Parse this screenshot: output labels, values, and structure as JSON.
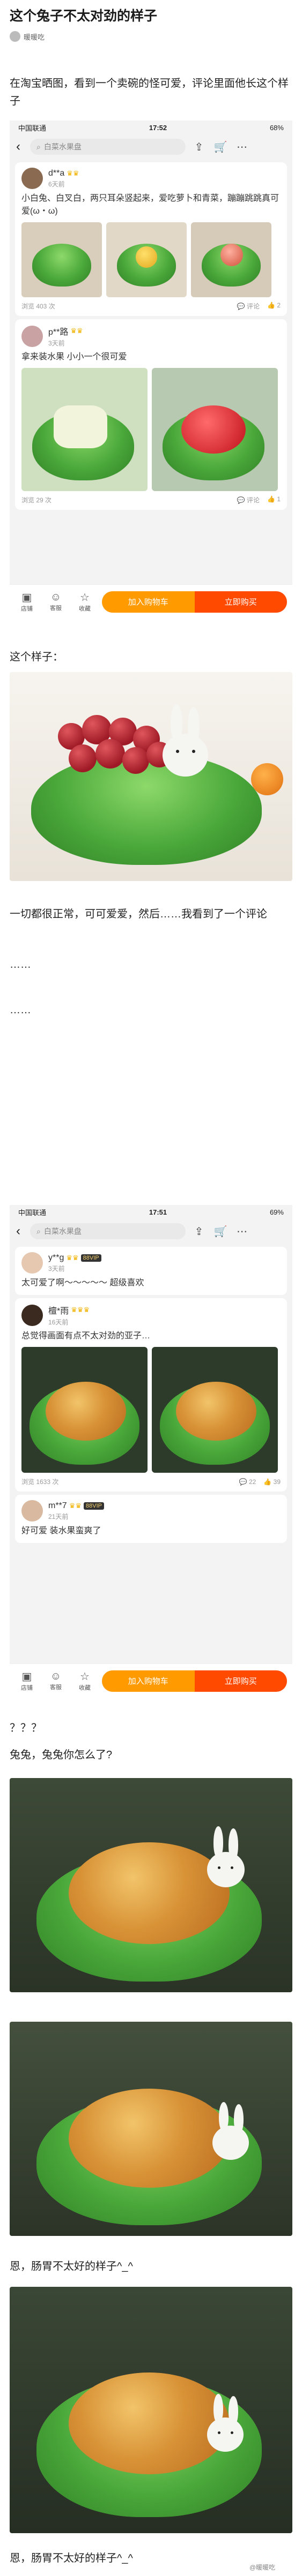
{
  "article": {
    "title": "这个兔子不太对劲的样子",
    "author": "暖暖吃",
    "intro": "在淘宝晒图，看到一个卖碗的怪可爱，评论里面他长这个样子",
    "para1": "这个样子：",
    "para2": "一切都很正常，可可爱爱，然后……我看到了一个评论",
    "ellipsis1": "……",
    "ellipsis2": "……",
    "q": "？？？",
    "q2": "兔兔，兔兔你怎么了?",
    "caption1": "恩，肠胃不太好的样子^_^",
    "caption2": "恩，肠胃不太好的样子^_^",
    "watermark": "@暖暖吃"
  },
  "phone1": {
    "carrier": "中国联通",
    "time": "17:52",
    "battery": "68%",
    "search_placeholder": "白菜水果盘",
    "comments": [
      {
        "user": "d**a",
        "date": "6天前",
        "text": "小白兔、白叉白，两只耳朵竖起来，爱吃萝卜和青菜，蹦蹦跳跳真可爱(ω・ω)",
        "views": "浏览 403 次",
        "r1": "评论",
        "r2": "2"
      },
      {
        "user": "p**路",
        "date": "3天前",
        "text": "拿来装水果 小小一个很可爱",
        "views": "浏览 29 次",
        "r1": "评论",
        "r2": "1"
      }
    ],
    "bar": {
      "shop": "店铺",
      "service": "客服",
      "fav": "收藏",
      "cart": "加入购物车",
      "buy": "立即购买"
    }
  },
  "phone2": {
    "carrier": "中国联通",
    "time": "17:51",
    "battery": "69%",
    "search_placeholder": "白菜水果盘",
    "comments": [
      {
        "user": "y**g",
        "vip": "88VIP",
        "date": "3天前",
        "text": "太可爱了啊～～～～～ 超级喜欢"
      },
      {
        "user": "檀*雨",
        "date": "16天前",
        "text": "总觉得画面有点不太对劲的亚子…",
        "views": "浏览 1633 次",
        "r1": "22",
        "r2": "39"
      },
      {
        "user": "m**7",
        "vip": "88VIP",
        "date": "21天前",
        "text": "好可爱 装水果蛮爽了"
      }
    ],
    "bar": {
      "shop": "店铺",
      "service": "客服",
      "fav": "收藏",
      "cart": "加入购物车",
      "buy": "立即购买"
    }
  }
}
